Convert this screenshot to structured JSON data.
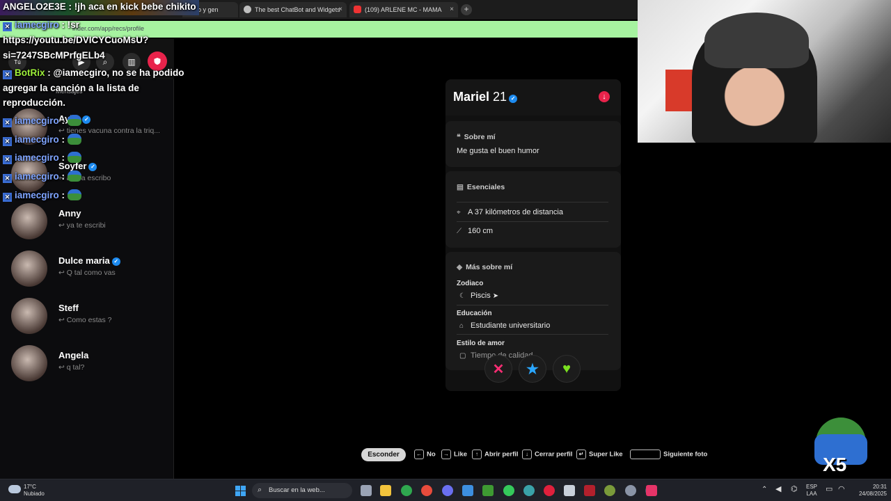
{
  "browser": {
    "tabs": [
      {
        "label": "o y gen",
        "left": 0
      },
      {
        "label": "The best ChatBot and Widgets",
        "close": "×"
      },
      {
        "label": "(109) ARLENE MC - MAMA",
        "close": "×"
      }
    ],
    "new_tab": "+",
    "url": "inder.com/app/recs/profile"
  },
  "chat": {
    "banner_user": "ANGELO2E3E",
    "banner_msg": "!jh aca en kick bebe chikito",
    "lines": [
      {
        "user": "iamecgiro",
        "msg": " : !sr"
      },
      {
        "user": "",
        "msg": "https://youtu.be/DVICYCuoMsU?"
      },
      {
        "user": "",
        "msg": "si=7247SBcMPrfgELb4"
      },
      {
        "user": "BotRix",
        "msg": " : @iamecgiro, no se ha podido"
      },
      {
        "user": "",
        "msg": "agregar la canción a la lista de"
      },
      {
        "user": "",
        "msg": "reproducción."
      },
      {
        "user": "iamecgiro",
        "msg": " :"
      },
      {
        "user": "iamecgiro",
        "msg": " :"
      },
      {
        "user": "iamecgiro",
        "msg": " :"
      },
      {
        "user": "iamecgiro",
        "msg": " :"
      },
      {
        "user": "iamecgiro",
        "msg": " :"
      }
    ]
  },
  "sidebar": {
    "header_label": "Tú",
    "tabs_label": "Mensajes",
    "matches": [
      {
        "name": "Aylin",
        "msg": "↩ tienes vacuna contra la triq...",
        "verified": true
      },
      {
        "name": "Soyfer",
        "msg": "↩ ahora escribo",
        "verified": true
      },
      {
        "name": "Anny",
        "msg": "↩ ya te escribi",
        "verified": false
      },
      {
        "name": "Dulce maria",
        "msg": "↩ Q tal como vas",
        "verified": true
      },
      {
        "name": "Steff",
        "msg": "↩ Como estas ?",
        "verified": false
      },
      {
        "name": "Angela",
        "msg": "↩ q tal?",
        "verified": false
      }
    ]
  },
  "profile": {
    "name": "Mariel",
    "age": "21",
    "about_title": "Sobre mí",
    "about_text": "Me gusta el buen humor",
    "essentials_title": "Esenciales",
    "distance": "A 37 kilómetros de distancia",
    "height": "160 cm",
    "more_title": "Más sobre mí",
    "zodiac_label": "Zodiaco",
    "zodiac_value": "Piscis",
    "education_label": "Educación",
    "education_value": "Estudiante universitario",
    "love_label": "Estilo de amor",
    "love_value": "Tiempo de calidad"
  },
  "shortcuts": {
    "hide": "Esconder",
    "no": "No",
    "like": "Like",
    "open_profile": "Abrir perfil",
    "close_profile": "Cerrar perfil",
    "super_like": "Super Like",
    "next_photo": "Siguiente foto"
  },
  "emote_text": "X5",
  "taskbar": {
    "temp": "17°C",
    "weather": "Nubiado",
    "search": "Buscar en la web...",
    "lang1": "ESP",
    "lang2": "LAA",
    "time": "20:31",
    "date": "24/08/2025"
  }
}
